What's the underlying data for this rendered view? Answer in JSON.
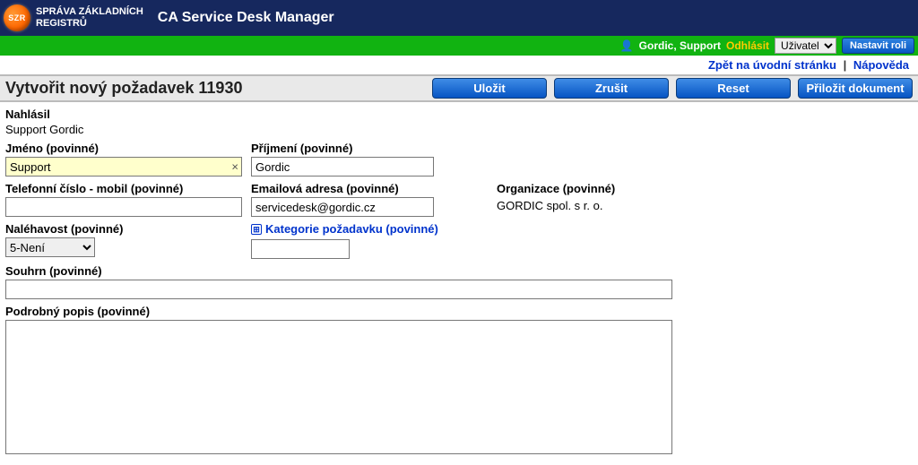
{
  "brand": {
    "logo_text": "SZR",
    "agency_line1": "SPRÁVA ZÁKLADNÍCH",
    "agency_line2": "REGISTRŮ",
    "app_title": "CA Service Desk Manager"
  },
  "topbar": {
    "user_name": "Gordic, Support",
    "logout": "Odhlásit",
    "role_selected": "Uživatel",
    "set_role_btn": "Nastavit roli"
  },
  "subnav": {
    "back_home": "Zpět na úvodní stránku",
    "help": "Nápověda"
  },
  "page": {
    "title": "Vytvořit nový požadavek 11930"
  },
  "actions": {
    "save": "Uložit",
    "cancel": "Zrušit",
    "reset": "Reset",
    "attach": "Přiložit dokument"
  },
  "form": {
    "reported_by_label": "Nahlásil",
    "reported_by_value": "Support Gordic",
    "first_name_label": "Jméno (povinné)",
    "first_name_value": "Support",
    "last_name_label": "Příjmení (povinné)",
    "last_name_value": "Gordic",
    "phone_label": "Telefonní číslo - mobil (povinné)",
    "phone_value": "",
    "email_label": "Emailová adresa (povinné)",
    "email_value": "servicedesk@gordic.cz",
    "org_label": "Organizace (povinné)",
    "org_value": "GORDIC spol. s r. o.",
    "urgency_label": "Naléhavost (povinné)",
    "urgency_value": "5-Není",
    "category_label": "Kategorie požadavku (povinné)",
    "category_value": "",
    "summary_label": "Souhrn (povinné)",
    "summary_value": "",
    "description_label": "Podrobný popis (povinné)",
    "description_value": ""
  }
}
